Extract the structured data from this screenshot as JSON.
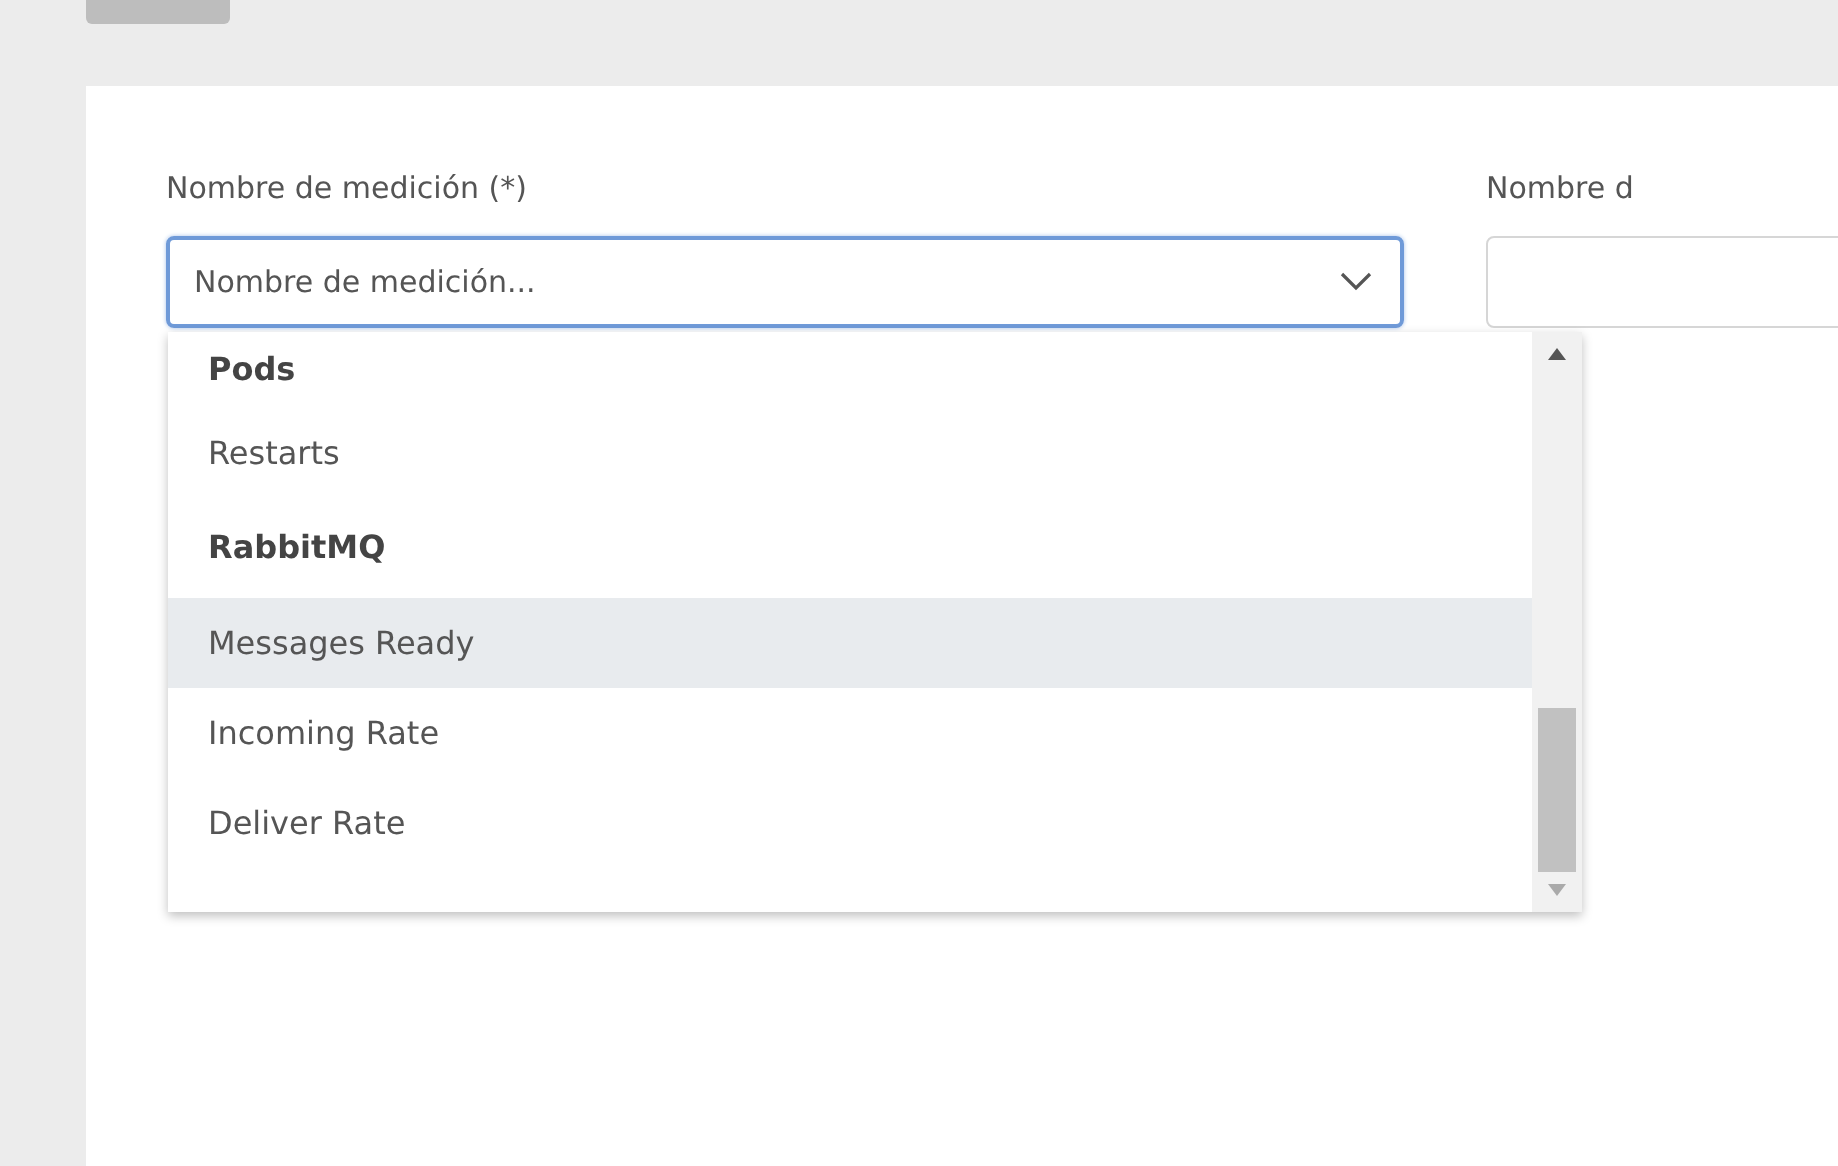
{
  "form": {
    "fields": [
      {
        "label": "Nombre de medición (*)",
        "placeholder": "Nombre de medición...",
        "kind": "select",
        "focused": true
      },
      {
        "label": "Nombre d",
        "kind": "text",
        "focused": false
      }
    ]
  },
  "dropdown": {
    "items": [
      {
        "text": "Pods",
        "kind": "group",
        "selected": false
      },
      {
        "text": "Restarts",
        "kind": "option",
        "selected": false
      },
      {
        "text": "RabbitMQ",
        "kind": "group",
        "selected": false
      },
      {
        "text": "Messages Ready",
        "kind": "option",
        "selected": true
      },
      {
        "text": "Incoming Rate",
        "kind": "option",
        "selected": false
      },
      {
        "text": "Deliver Rate",
        "kind": "option",
        "selected": false
      }
    ]
  }
}
